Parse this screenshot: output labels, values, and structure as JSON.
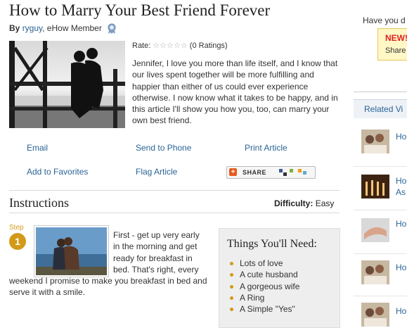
{
  "article": {
    "title": "How to Marry Your Best Friend Forever",
    "by_label": "By",
    "author": "ryguy",
    "author_role": ", eHow Member",
    "rate_label": "Rate:",
    "ratings": "(0 Ratings)",
    "intro": "Jennifer, I love you more than life itself, and I know that our lives spent together will be more fulfilling and happier than either of us could ever experience otherwise. I now know what it takes to be happy, and in this article I'll show you how you, too, can marry your own best friend."
  },
  "actions": {
    "email": "Email",
    "send_to_phone": "Send to Phone",
    "print": "Print Article",
    "favorites": "Add to Favorites",
    "flag": "Flag Article",
    "share": "SHARE"
  },
  "instructions": {
    "heading": "Instructions",
    "difficulty_label": "Difficulty:",
    "difficulty_value": "Easy",
    "step_label": "Step",
    "step_number": "1",
    "step_text_a": "First - get up very early in the morning and get ready for breakfast in bed. That's right, every",
    "step_text_b": "weekend I promise to make you breakfast in bed and serve it with a smile."
  },
  "needs": {
    "heading": "Things You'll Need:",
    "items": [
      "Lots of love",
      "A cute husband",
      "A gorgeous wife",
      "A Ring",
      "A Simple \"Yes\""
    ]
  },
  "rail": {
    "question": "Have you d",
    "promo_new": "NEW!",
    "promo_share": "Share",
    "related_heading": "Related Vi",
    "items": [
      "Ho",
      "Ho",
      "As",
      "Ho",
      "Ho",
      "Ho"
    ]
  },
  "colors": {
    "link": "#2a6496",
    "accent": "#d29a18"
  }
}
